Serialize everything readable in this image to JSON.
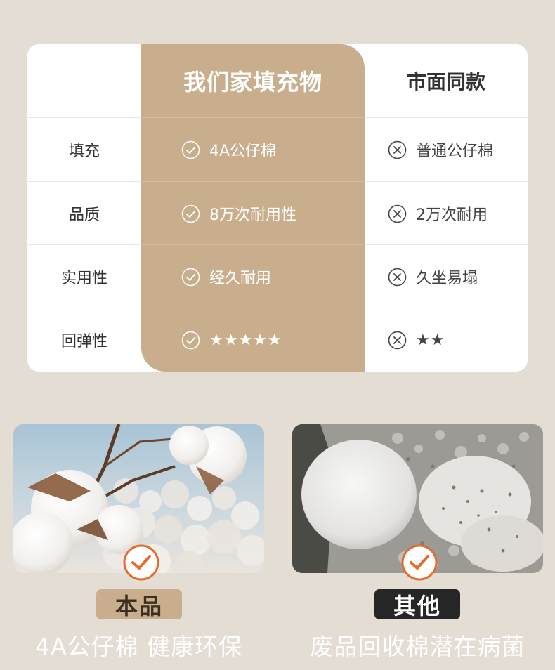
{
  "colors": {
    "page_bg": "#e4ddd3",
    "accent_tan": "#c9ae8d",
    "card_bg": "#ffffff",
    "dark_pill": "#262626",
    "check_orange": "#e66a2c"
  },
  "table": {
    "header_ours": "我们家填充物",
    "header_market": "市面同款",
    "rows": [
      {
        "label": "填充",
        "ours": "4A公仔棉",
        "market": "普通公仔棉"
      },
      {
        "label": "品质",
        "ours": "8万次耐用性",
        "market": "2万次耐用"
      },
      {
        "label": "实用性",
        "ours": "经久耐用",
        "market": "久坐易塌"
      },
      {
        "label": "回弹性",
        "ours": "★★★★★",
        "market": "★★"
      }
    ],
    "icons": {
      "ours": "check-circle-icon",
      "market": "x-circle-icon"
    }
  },
  "compare": {
    "left": {
      "tag": "本品",
      "caption": "4A公仔棉 健康环保",
      "badge_icon": "check-badge-icon"
    },
    "right": {
      "tag": "其他",
      "caption": "废品回收棉潜在病菌",
      "badge_icon": "check-badge-icon"
    }
  }
}
